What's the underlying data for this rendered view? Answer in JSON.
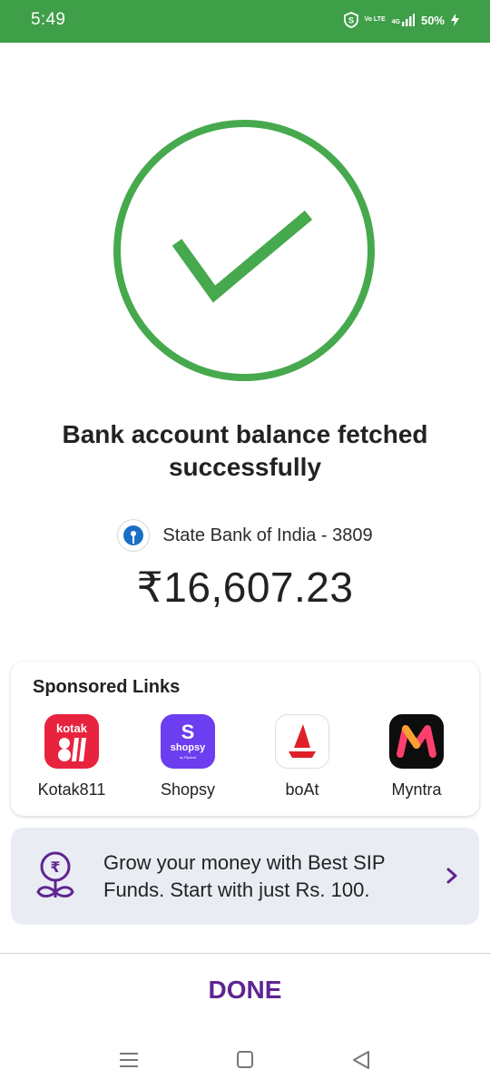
{
  "status_bar": {
    "time": "5:49",
    "battery": "50%",
    "volte_label": "Vo LTE",
    "network_label": "4G",
    "background_color": "#3f9e48"
  },
  "result": {
    "icon": "check-circle-icon",
    "color": "#46a94d",
    "headline": "Bank account balance fetched successfully"
  },
  "account": {
    "bank_label": "State Bank of India - 3809",
    "bank_icon": "sbi-logo-icon",
    "balance": "₹16,607.23"
  },
  "sponsored": {
    "title": "Sponsored Links",
    "apps": [
      {
        "name": "Kotak811",
        "icon_text": "kotak",
        "icon_sub": "811",
        "color": "#e8233d"
      },
      {
        "name": "Shopsy",
        "icon_text": "S",
        "icon_sub": "shopsy",
        "icon_sub2": "by Flipkart",
        "color": "#6d3df0"
      },
      {
        "name": "boAt",
        "icon": "boat-sail-icon",
        "color": "#ffffff"
      },
      {
        "name": "Myntra",
        "icon": "myntra-m-icon",
        "color": "#0d0d0d"
      }
    ]
  },
  "sip_banner": {
    "icon": "rupee-plant-icon",
    "text": "Grow your money with Best SIP Funds. Start with just Rs. 100.",
    "chevron": "chevron-right-icon",
    "accent_color": "#5f2591"
  },
  "footer": {
    "done_label": "DONE"
  },
  "navigation": {
    "recents": "menu-icon",
    "home": "square-icon",
    "back": "back-triangle-icon"
  }
}
